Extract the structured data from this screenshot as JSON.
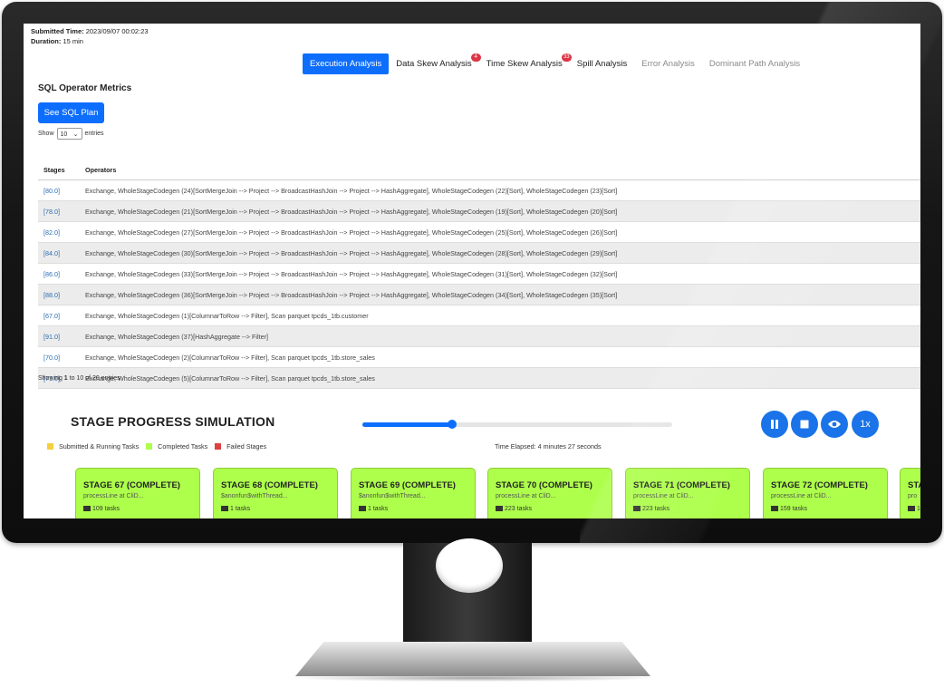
{
  "header": {
    "submitted_label": "Submitted Time:",
    "submitted_value": "2023/09/07 00:02:23",
    "duration_label": "Duration:",
    "duration_value": "15 min"
  },
  "tabs": [
    {
      "label": "Execution Analysis",
      "badge": ""
    },
    {
      "label": "Data Skew Analysis",
      "badge": "4"
    },
    {
      "label": "Time Skew Analysis",
      "badge": "33"
    },
    {
      "label": "Spill Analysis",
      "badge": ""
    },
    {
      "label": "Error Analysis",
      "badge": ""
    },
    {
      "label": "Dominant Path Analysis",
      "badge": ""
    }
  ],
  "section": {
    "title": "SQL Operator Metrics",
    "plan_button": "See SQL Plan",
    "show_label": "Show",
    "show_value": "10",
    "entries_label": "entries"
  },
  "table": {
    "headers": [
      "Stages",
      "Operators"
    ],
    "rows": [
      [
        "[80.0]",
        "Exchange, WholeStageCodegen (24)[SortMergeJoin --> Project --> BroadcastHashJoin --> Project --> HashAggregate], WholeStageCodegen (22)[Sort], WholeStageCodegen (23)[Sort]"
      ],
      [
        "[78.0]",
        "Exchange, WholeStageCodegen (21)[SortMergeJoin --> Project --> BroadcastHashJoin --> Project --> HashAggregate], WholeStageCodegen (19)[Sort], WholeStageCodegen (20)[Sort]"
      ],
      [
        "[82.0]",
        "Exchange, WholeStageCodegen (27)[SortMergeJoin --> Project --> BroadcastHashJoin --> Project --> HashAggregate], WholeStageCodegen (25)[Sort], WholeStageCodegen (26)[Sort]"
      ],
      [
        "[84.0]",
        "Exchange, WholeStageCodegen (30)[SortMergeJoin --> Project --> BroadcastHashJoin --> Project --> HashAggregate], WholeStageCodegen (28)[Sort], WholeStageCodegen (29)[Sort]"
      ],
      [
        "[86.0]",
        "Exchange, WholeStageCodegen (33)[SortMergeJoin --> Project --> BroadcastHashJoin --> Project --> HashAggregate], WholeStageCodegen (31)[Sort], WholeStageCodegen (32)[Sort]"
      ],
      [
        "[88.0]",
        "Exchange, WholeStageCodegen (36)[SortMergeJoin --> Project --> BroadcastHashJoin --> Project --> HashAggregate], WholeStageCodegen (34)[Sort], WholeStageCodegen (35)[Sort]"
      ],
      [
        "[67.0]",
        "Exchange, WholeStageCodegen (1)[ColumnarToRow --> Filter], Scan parquet tpcds_1tb.customer"
      ],
      [
        "[91.0]",
        "Exchange, WholeStageCodegen (37)[HashAggregate --> Filter]"
      ],
      [
        "[70.0]",
        "Exchange, WholeStageCodegen (2)[ColumnarToRow --> Filter], Scan parquet tpcds_1tb.store_sales"
      ],
      [
        "[71.0]",
        "Exchange, WholeStageCodegen (5)[ColumnarToRow --> Filter], Scan parquet tpcds_1tb.store_sales"
      ]
    ],
    "footer_prefix": "Showing ",
    "footer_from": "1",
    "footer_mid": " to 10 of 20 entries"
  },
  "simulation": {
    "title": "STAGE PROGRESS SIMULATION",
    "progress": 0.29,
    "controls": [
      "pause-icon",
      "stop-icon",
      "eye-icon"
    ],
    "speed_label": "1x",
    "legend": [
      {
        "label": "Submitted & Running Tasks",
        "color": "#f4d03f"
      },
      {
        "label": "Completed Tasks",
        "color": "#adff4b"
      },
      {
        "label": "Failed Stages",
        "color": "#e04040"
      }
    ],
    "elapsed": "Time Elapsed: 4 minutes 27 seconds",
    "accent": "#1a73e8"
  },
  "stages": [
    {
      "title": "STAGE 67 (COMPLETE)",
      "sub": "processLine at CliD...",
      "tasks": "109 tasks"
    },
    {
      "title": "STAGE 68 (COMPLETE)",
      "sub": "$anonfun$withThread...",
      "tasks": "1 tasks"
    },
    {
      "title": "STAGE 69 (COMPLETE)",
      "sub": "$anonfun$withThread...",
      "tasks": "1 tasks"
    },
    {
      "title": "STAGE 70 (COMPLETE)",
      "sub": "processLine at CliD...",
      "tasks": "223 tasks"
    },
    {
      "title": "STAGE 71 (COMPLETE)",
      "sub": "processLine at CliD...",
      "tasks": "223 tasks"
    },
    {
      "title": "STAGE 72 (COMPLETE)",
      "sub": "processLine at CliD...",
      "tasks": "159 tasks"
    },
    {
      "title": "STA",
      "sub": "pro",
      "tasks": "1"
    }
  ]
}
